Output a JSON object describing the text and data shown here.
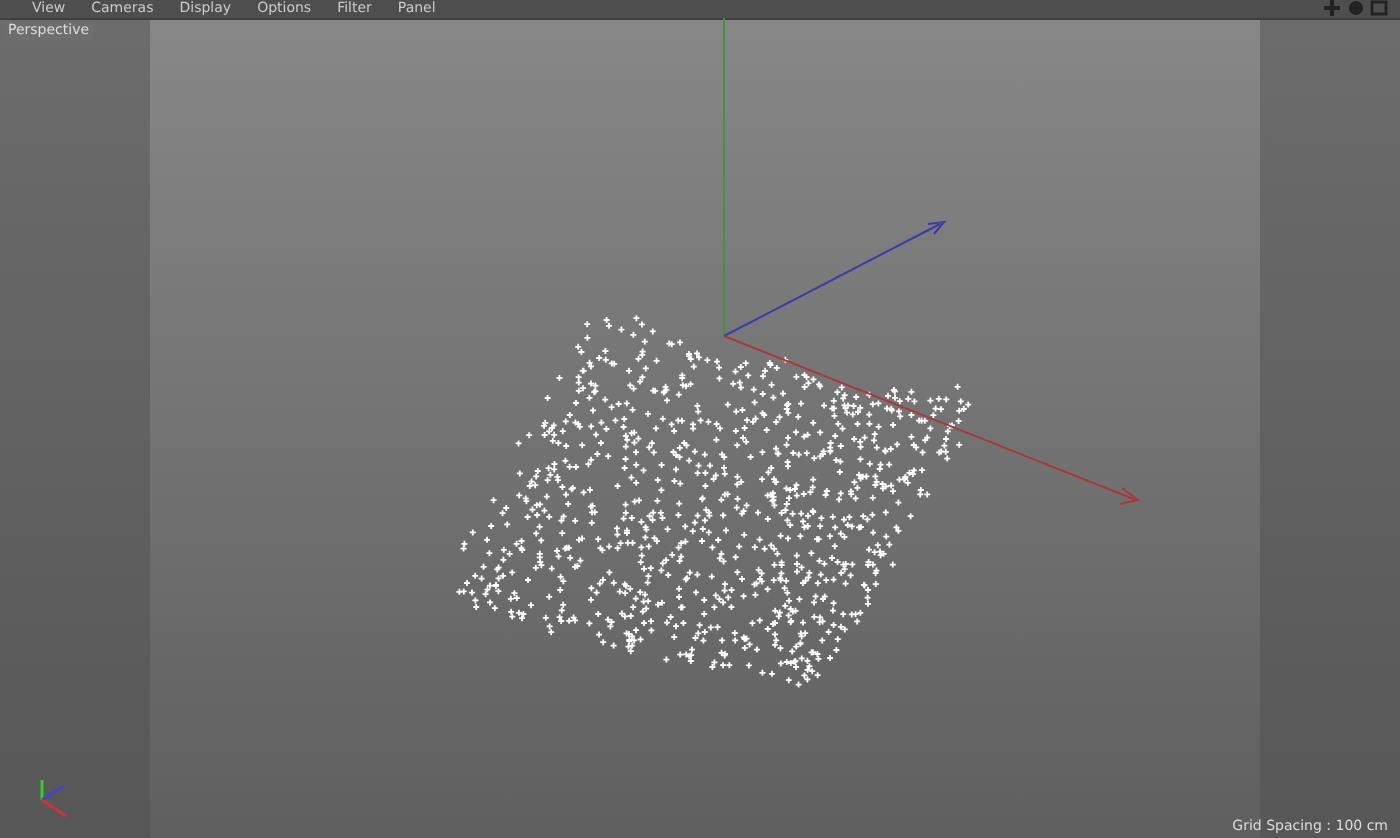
{
  "menu": [
    "View",
    "Cameras",
    "Display",
    "Options",
    "Filter",
    "Panel"
  ],
  "viewport": {
    "label": "Perspective",
    "grid_spacing": "Grid Spacing : 100 cm"
  }
}
